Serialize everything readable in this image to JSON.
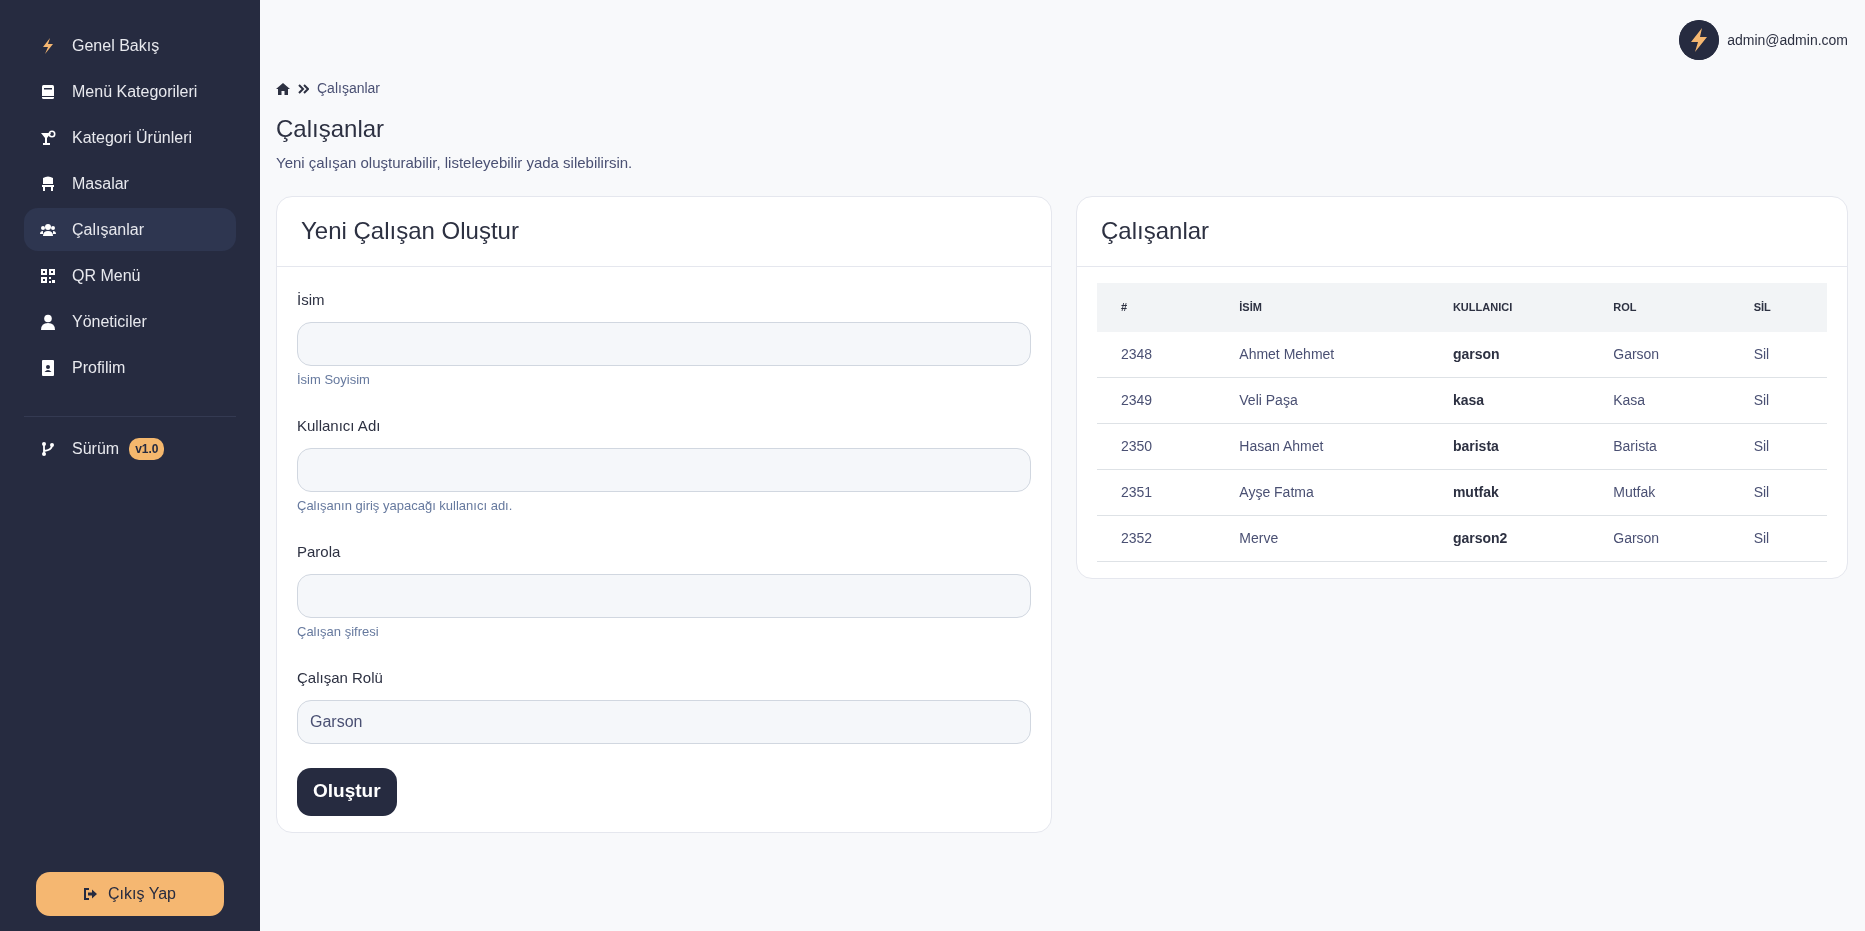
{
  "sidebar": {
    "items": [
      {
        "label": "Genel Bakış",
        "selected": false
      },
      {
        "label": "Menü Kategorileri",
        "selected": false
      },
      {
        "label": "Kategori Ürünleri",
        "selected": false
      },
      {
        "label": "Masalar",
        "selected": false
      },
      {
        "label": "Çalışanlar",
        "selected": true
      },
      {
        "label": "QR Menü",
        "selected": false
      },
      {
        "label": "Yöneticiler",
        "selected": false
      },
      {
        "label": "Profilim",
        "selected": false
      }
    ],
    "version": {
      "label": "Sürüm",
      "badge": "v1.0"
    },
    "logout": "Çıkış Yap"
  },
  "header": {
    "user": "admin@admin.com"
  },
  "breadcrumb": [
    "Çalışanlar"
  ],
  "page": {
    "title": "Çalışanlar",
    "subtitle": "Yeni çalışan oluşturabilir, listeleyebilir yada silebilirsin."
  },
  "form": {
    "title": "Yeni Çalışan Oluştur",
    "fields": [
      {
        "kind": "text",
        "label": "İsim",
        "help": "İsim Soyisim"
      },
      {
        "kind": "text",
        "label": "Kullanıcı Adı",
        "help": "Çalışanın giriş yapacağı kullanıcı adı."
      },
      {
        "kind": "password",
        "label": "Parola",
        "help": "Çalışan şifresi"
      },
      {
        "kind": "select",
        "label": "Çalışan Rolü",
        "value": "Garson"
      }
    ],
    "submit": "Oluştur"
  },
  "table": {
    "title": "Çalışanlar",
    "columns": [
      "#",
      "İSİM",
      "KULLANICI",
      "ROL",
      "SİL"
    ],
    "rows": [
      [
        "2348",
        "Ahmet Mehmet",
        "garson",
        "Garson",
        "Sil"
      ],
      [
        "2349",
        "Veli Paşa",
        "kasa",
        "Kasa",
        "Sil"
      ],
      [
        "2350",
        "Hasan Ahmet",
        "barista",
        "Barista",
        "Sil"
      ],
      [
        "2351",
        "Ayşe Fatma",
        "mutfak",
        "Mutfak",
        "Sil"
      ],
      [
        "2352",
        "Merve",
        "garson2",
        "Garson",
        "Sil"
      ]
    ]
  }
}
